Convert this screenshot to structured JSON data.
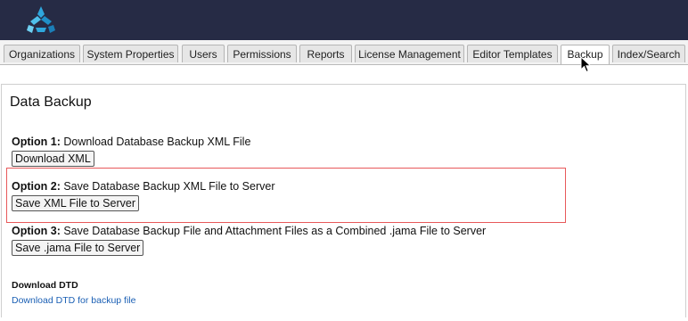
{
  "tabs": [
    {
      "label": "Organizations"
    },
    {
      "label": "System Properties"
    },
    {
      "label": "Users"
    },
    {
      "label": "Permissions"
    },
    {
      "label": "Reports"
    },
    {
      "label": "License Management"
    },
    {
      "label": "Editor Templates"
    },
    {
      "label": "Backup",
      "active": true
    },
    {
      "label": "Index/Search"
    }
  ],
  "page": {
    "title": "Data Backup"
  },
  "options": [
    {
      "prefix": "Option 1:",
      "text": "Download Database Backup XML File",
      "button": "Download XML"
    },
    {
      "prefix": "Option 2:",
      "text": "Save Database Backup XML File to Server",
      "button": "Save XML File to Server"
    },
    {
      "prefix": "Option 3:",
      "text": "Save Database Backup File and Attachment Files as a Combined .jama File to Server",
      "button": "Save .jama File to Server"
    }
  ],
  "dtd": {
    "title": "Download DTD",
    "link": "Download DTD for backup file"
  },
  "colors": {
    "header_bg": "#262b45",
    "highlight": "#e8595a",
    "link": "#1a5fb4",
    "logo": "#2fa7dd"
  },
  "icons": {
    "logo": "jama-logo-icon",
    "cursor": "mouse-pointer-icon"
  }
}
